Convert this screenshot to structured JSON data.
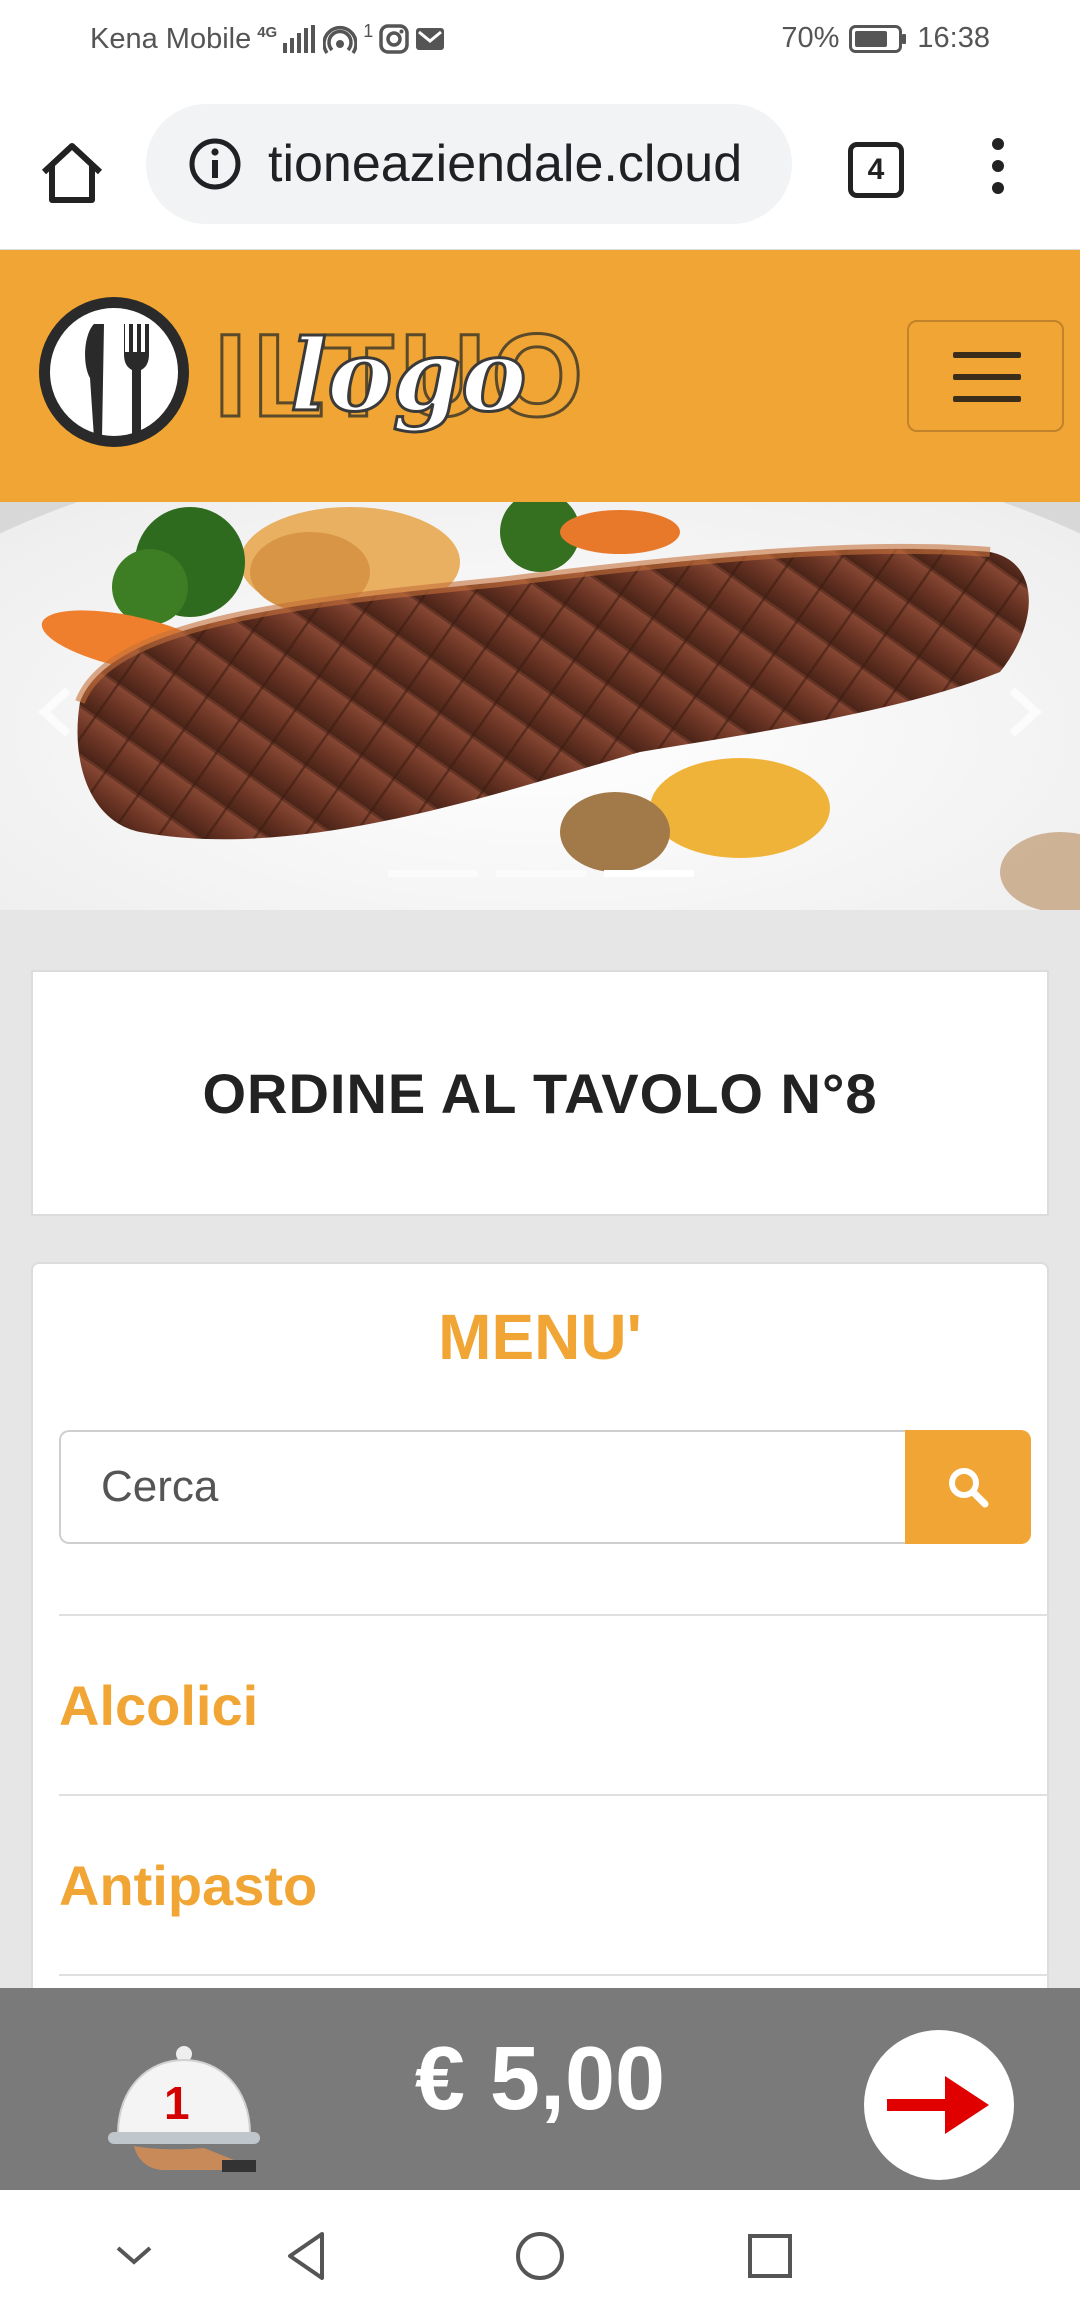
{
  "status_bar": {
    "carrier": "Kena Mobile",
    "network": "4G",
    "notification_count": "1",
    "battery": "70%",
    "time": "16:38",
    "icons": [
      "signal-icon",
      "hotspot-icon",
      "instagram-icon",
      "mail-icon",
      "battery-icon"
    ]
  },
  "browser": {
    "url": "tioneaziendale.cloud",
    "tab_count": "4",
    "icons": [
      "home-icon",
      "info-icon",
      "tabs-icon",
      "more-vert-icon"
    ]
  },
  "header": {
    "logo_text_main": "ILTUO",
    "logo_text_script": "logo",
    "menu_icon": "hamburger-icon"
  },
  "carousel": {
    "slide_count": 3,
    "active_index": 2
  },
  "order": {
    "title": "ORDINE AL TAVOLO N°8"
  },
  "menu": {
    "title": "MENU'",
    "search_placeholder": "Cerca",
    "categories": [
      "Alcolici",
      "Antipasto",
      ""
    ]
  },
  "cart": {
    "count": "1",
    "total": "€ 5,00"
  },
  "colors": {
    "accent": "#f0a535",
    "bottom_bar": "#7a7a7a",
    "arrow": "#e00000"
  }
}
